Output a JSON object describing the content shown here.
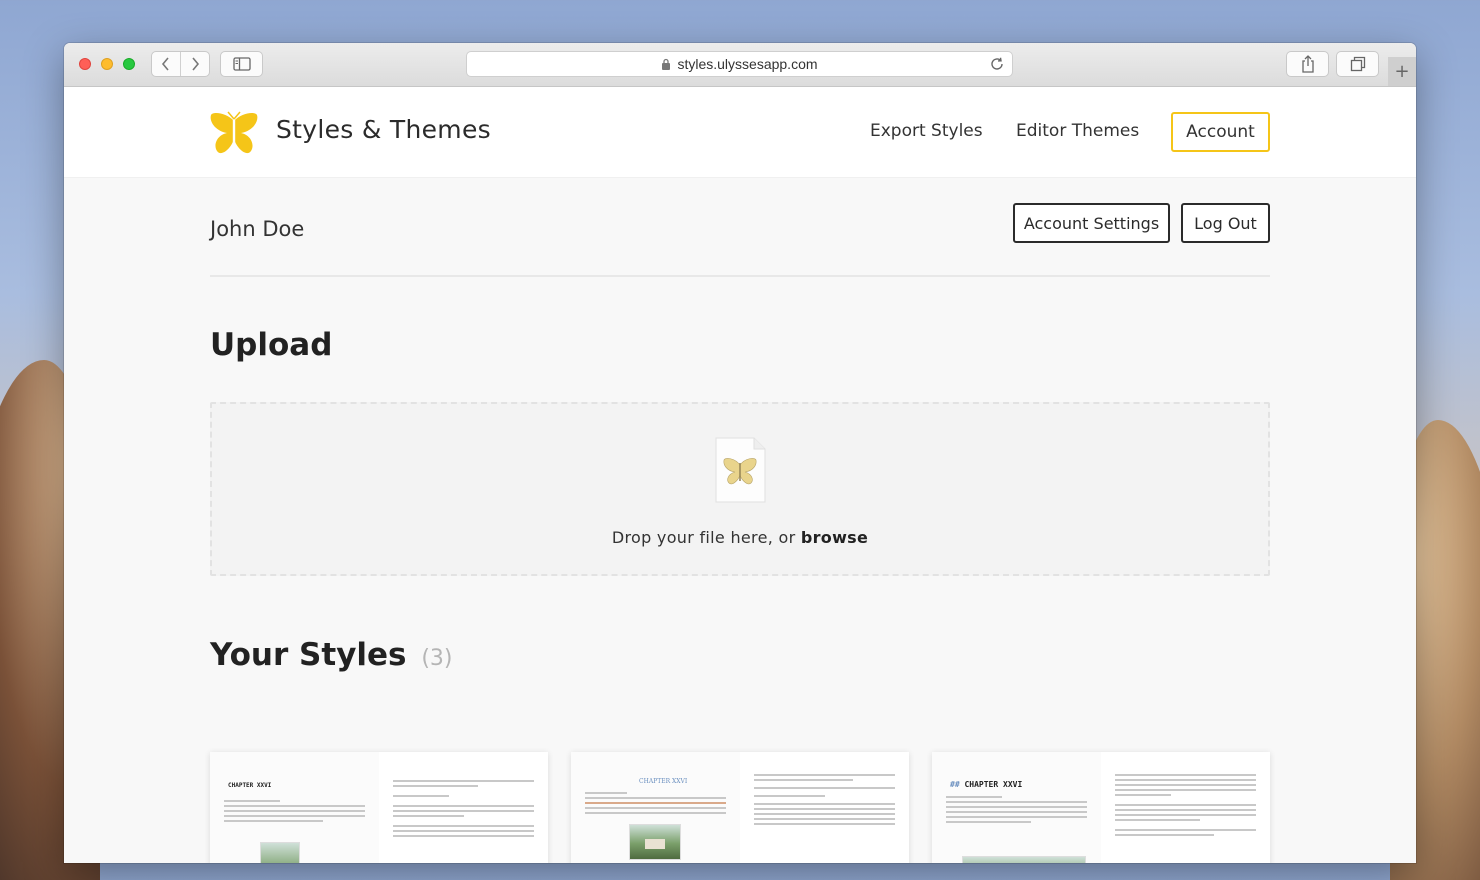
{
  "browser": {
    "url": "styles.ulyssesapp.com",
    "new_tab_symbol": "+"
  },
  "header": {
    "brand": "Styles & Themes",
    "nav": {
      "export_styles": "Export Styles",
      "editor_themes": "Editor Themes",
      "account": "Account"
    }
  },
  "account": {
    "user_name": "John Doe",
    "settings_label": "Account Settings",
    "logout_label": "Log Out"
  },
  "upload": {
    "title": "Upload",
    "drop_text": "Drop your file here, or ",
    "browse_label": "browse"
  },
  "styles": {
    "title": "Your Styles",
    "count": "(3)",
    "cards": [
      {
        "chapter": "CHAPTER XXVI"
      },
      {
        "chapter": "CHAPTER XXVI"
      },
      {
        "chapter_hash": "##",
        "chapter": "CHAPTER XXVI"
      }
    ]
  },
  "colors": {
    "accent": "#f5c518",
    "text": "#2b2b2b"
  }
}
